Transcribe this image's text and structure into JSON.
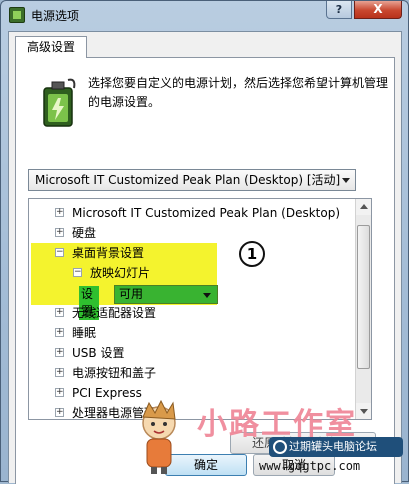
{
  "window": {
    "title": "电源选项",
    "help_label": "?",
    "close_label": "X"
  },
  "tab": {
    "label": "高级设置"
  },
  "intro": {
    "text": "选择您要自定义的电源计划，然后选择您希望计算机管理的电源设置。"
  },
  "plan_select": {
    "value": "Microsoft IT Customized Peak Plan (Desktop) [活动]"
  },
  "tree": {
    "items": [
      {
        "toggle": "+",
        "label": "Microsoft IT Customized Peak Plan (Desktop)"
      },
      {
        "toggle": "+",
        "label": "硬盘"
      },
      {
        "toggle": "−",
        "label": "桌面背景设置"
      },
      {
        "toggle": "−",
        "label": "放映幻灯片"
      },
      {
        "toggle": "+",
        "label": "无线适配器设置"
      },
      {
        "toggle": "+",
        "label": "睡眠"
      },
      {
        "toggle": "+",
        "label": "USB 设置"
      },
      {
        "toggle": "+",
        "label": "电源按钮和盖子"
      },
      {
        "toggle": "+",
        "label": "PCI Express"
      },
      {
        "toggle": "+",
        "label": "处理器电源管理"
      }
    ],
    "setting": {
      "label": "设置:",
      "value": "可用"
    },
    "callout": "1"
  },
  "buttons": {
    "restore": "还原计划默认值(R)",
    "ok": "确定",
    "cancel": "取消"
  },
  "watermark": {
    "brand": "小路工作室",
    "badge": "过期罐头电脑论坛",
    "url": "www.gqgtpc.com"
  }
}
